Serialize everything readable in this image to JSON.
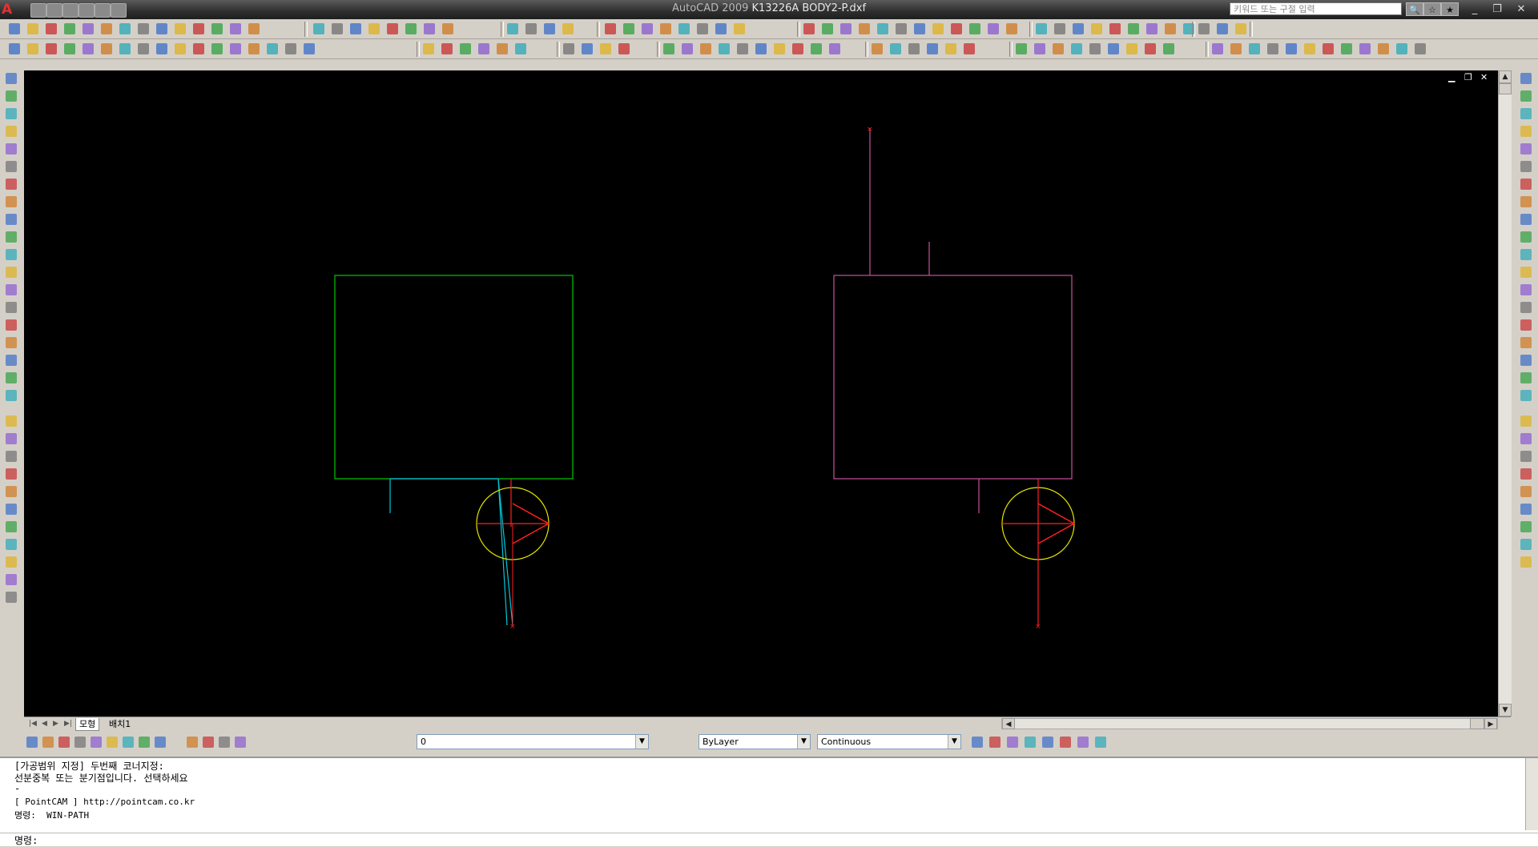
{
  "window": {
    "app_name": "AutoCAD 2009",
    "file_name": "K13226A BODY2-P.dxf",
    "search_placeholder": "키워드 또는 구절 입력",
    "app_logo": "A",
    "controls": {
      "minimize": "_",
      "restore": "❐",
      "close": "✕"
    },
    "viewport_controls": {
      "minimize": "▁",
      "restore": "❐",
      "close": "✕"
    }
  },
  "colors": {
    "canvas": "#000000",
    "green_rect": "#00c800",
    "magenta_rect": "#c850a0",
    "cyan_path": "#00c8dc",
    "red_marker": "#ff2020",
    "yellow_circle": "#e6e600"
  },
  "tabs": {
    "model": "모형",
    "layout1": "배치1"
  },
  "layer_bar": {
    "layer_value": "0",
    "color_value": "ByLayer",
    "linetype_value": "Continuous"
  },
  "command_lines": [
    "[가공범위 지정] 두번째 코너지정:",
    "선분중복 또는 분기점입니다. 선택하세요",
    "-",
    "[ PointCAM ] http://pointcam.co.kr",
    "명령:  WIN-PATH"
  ],
  "command_prompt": "명령:",
  "icons": {
    "toolbar_row1": [
      "new-file-icon",
      "open-file-icon",
      "save-icon",
      "print-icon",
      "undo-icon",
      "redo-icon"
    ],
    "side_left": [
      "erase-icon",
      "copy-icon",
      "mirror-icon",
      "offset-icon",
      "array-icon",
      "move-icon",
      "rotate-icon",
      "scale-icon",
      "stretch-icon",
      "trim-icon",
      "extend-icon",
      "break-icon",
      "join-icon",
      "chamfer-icon",
      "fillet-icon",
      "explode-icon",
      "text-icon",
      "multiline-text-icon",
      "text-style-icon"
    ],
    "side_right": [
      "dimension-linear-icon",
      "dimension-aligned-icon",
      "dimension-arc-icon",
      "dimension-radius-icon",
      "dimension-diameter-icon",
      "dimension-angular-icon",
      "quick-dimension-icon",
      "leader-icon",
      "tolerance-icon",
      "center-mark-icon"
    ]
  }
}
